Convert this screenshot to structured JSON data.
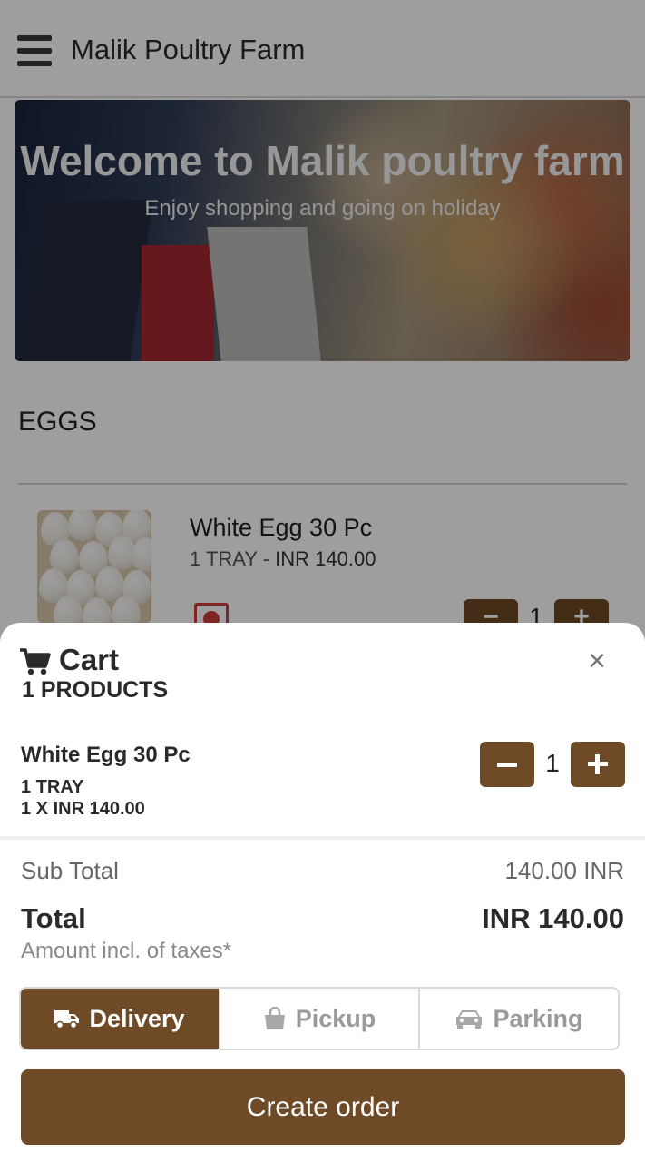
{
  "app": {
    "title": "Malik Poultry Farm"
  },
  "hero": {
    "title": "Welcome to Malik poultry farm",
    "subtitle": "Enjoy shopping and going on holiday"
  },
  "catalog": {
    "category": "EGGS",
    "product": {
      "name": "White Egg 30 Pc",
      "unit": "1 TRAY",
      "separator": " - ",
      "price": "INR 140.00",
      "quantity": "1"
    }
  },
  "cart": {
    "title": "Cart",
    "count_label": "1 PRODUCTS",
    "items": [
      {
        "name": "White Egg 30 Pc",
        "unit": "1 TRAY",
        "line_price": "1 X INR 140.00",
        "quantity": "1"
      }
    ],
    "subtotal_label": "Sub Total",
    "subtotal_value": "140.00 INR",
    "total_label": "Total",
    "total_value": "INR 140.00",
    "tax_note": "Amount incl. of taxes*",
    "modes": [
      {
        "label": "Delivery",
        "icon": "truck-icon",
        "active": true
      },
      {
        "label": "Pickup",
        "icon": "shopping-bag-icon",
        "active": false
      },
      {
        "label": "Parking",
        "icon": "car-icon",
        "active": false
      }
    ],
    "create_order_label": "Create order",
    "close_symbol": "×"
  },
  "colors": {
    "accent": "#6f4a26",
    "overlay": "rgba(0,0,0,0.38)"
  }
}
